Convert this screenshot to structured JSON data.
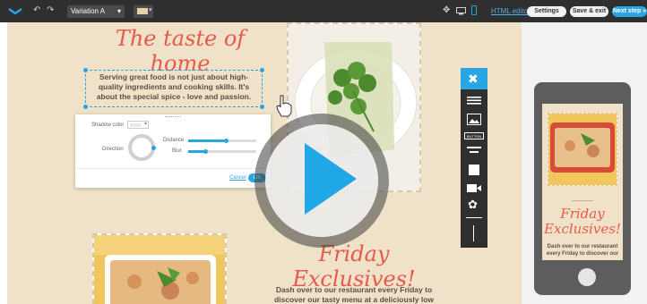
{
  "toolbar": {
    "variation_select": "Variation A",
    "html_editor": "HTML editor",
    "settings": "Settings",
    "save_exit": "Save & exit",
    "next_step": "Next step »"
  },
  "canvas": {
    "heading_1": "The taste of home",
    "paragraph_1": "Serving great food is not just about high-quality ingredients and cooking skills. It's about the special spice - love and passion.",
    "heading_2": "Friday Exclusives!",
    "paragraph_2_line1": "Dash over to our restaurant every Friday to",
    "paragraph_2_line2": "discover our tasty menu at a deliciously low"
  },
  "shadow_panel": {
    "shadow_color_label": "Shadow color",
    "direction_label": "Direction",
    "distance_label": "Distance",
    "blur_label": "Blur",
    "cancel": "Cancel",
    "ok": "OK",
    "distance_level": 0.55,
    "blur_level": 0.25
  },
  "side_toolbar": {
    "button_label": "BUTTON",
    "icons": [
      "tools-icon",
      "text-icon",
      "image-icon",
      "button-icon",
      "divider-icon",
      "spacer-icon",
      "video-icon",
      "twitter-icon",
      "line-icon"
    ]
  },
  "phone_preview": {
    "heading_line1": "Friday",
    "heading_line2": "Exclusives!",
    "text_line1": "Dash over to our restaurant",
    "text_line2": "every Friday to discover our"
  },
  "colors": {
    "accent": "#29a5e2",
    "canvas_bg": "#f0e2c9",
    "heading": "#e65a4b",
    "toolbar": "#2f2f2f"
  }
}
